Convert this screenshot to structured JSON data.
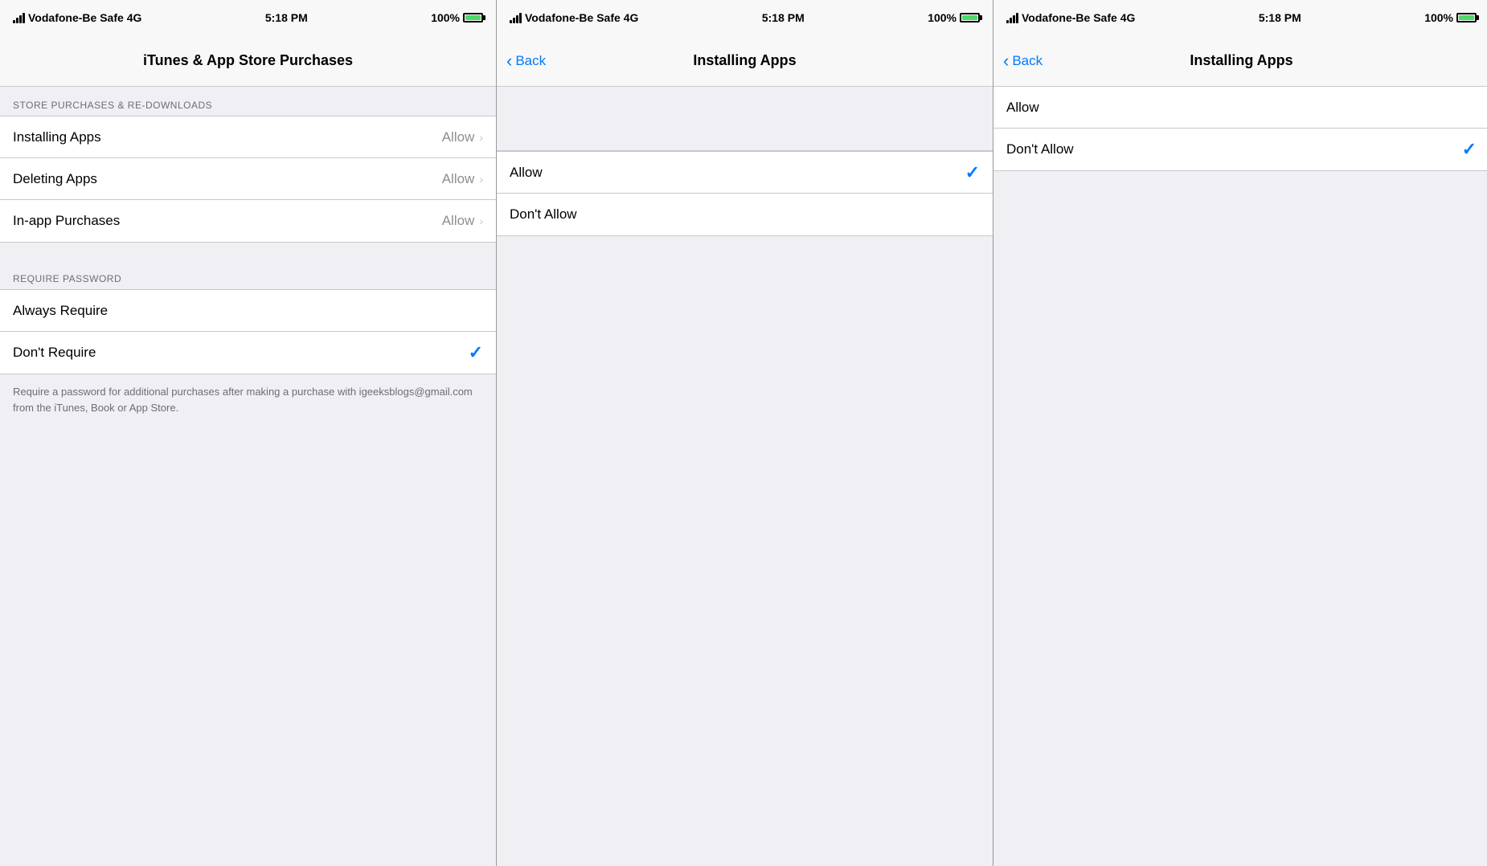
{
  "colors": {
    "blue": "#007aff",
    "gray_bg": "#efeff4",
    "white": "#ffffff",
    "separator": "#c8c7cc",
    "dark_text": "#000000",
    "gray_text": "#8e8e93",
    "section_header": "#6d6d72",
    "green": "#4cd964"
  },
  "panel1": {
    "status_bar": {
      "carrier": "Vodafone-Be Safe",
      "network": "4G",
      "time": "5:18 PM",
      "battery": "100%"
    },
    "nav_title": "iTunes & App Store Purchases",
    "section_store": "STORE PURCHASES & RE-DOWNLOADS",
    "rows": [
      {
        "label": "Installing Apps",
        "value": "Allow",
        "has_chevron": true,
        "selected": true
      },
      {
        "label": "Deleting Apps",
        "value": "Allow",
        "has_chevron": true
      },
      {
        "label": "In-app Purchases",
        "value": "Allow",
        "has_chevron": true
      }
    ],
    "section_password": "REQUIRE PASSWORD",
    "password_rows": [
      {
        "label": "Always Require",
        "checkmark": false
      },
      {
        "label": "Don't Require",
        "checkmark": true
      }
    ],
    "footer": "Require a password for additional purchases after making a purchase with igeeksblogs@gmail.com from the iTunes, Book or App Store."
  },
  "panel2": {
    "status_bar": {
      "carrier": "Vodafone-Be Safe",
      "network": "4G",
      "time": "5:18 PM",
      "battery": "100%"
    },
    "nav_back": "Back",
    "nav_title": "Installing Apps",
    "options": [
      {
        "label": "Allow",
        "selected": true
      },
      {
        "label": "Don't Allow",
        "selected": false
      }
    ]
  },
  "panel3": {
    "status_bar": {
      "carrier": "Vodafone-Be Safe",
      "network": "4G",
      "time": "5:18 PM",
      "battery": "100%"
    },
    "nav_back": "Back",
    "nav_title": "Installing Apps",
    "options": [
      {
        "label": "Allow",
        "selected": false
      },
      {
        "label": "Don't Allow",
        "selected": true
      }
    ]
  }
}
